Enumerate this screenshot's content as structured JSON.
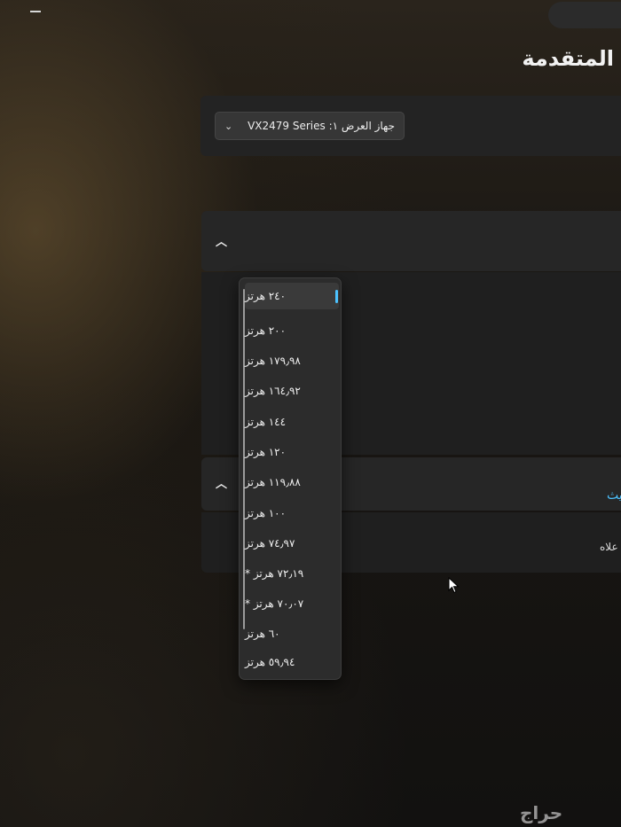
{
  "page": {
    "title": "المتقدمة"
  },
  "display": {
    "select_label": "جهاز العرض ١: VX2479 Series"
  },
  "sections": {
    "section2_link_fragment": "يث",
    "section2_text_fragment": "علاه"
  },
  "refresh_rate_dropdown": {
    "selected_index": 0,
    "options": [
      "٢٤٠ هرتز",
      "٢٠٠ هرتز",
      "١٧٩٫٩٨ هرتز",
      "١٦٤٫٩٢ هرتز",
      "١٤٤ هرتز",
      "١٢٠ هرتز",
      "١١٩٫٨٨ هرتز",
      "١٠٠ هرتز",
      "٧٤٫٩٧ هرتز",
      "٧٢٫١٩ هرتز *",
      "٧٠٫٠٧ هرتز *",
      "٦٠ هرتز",
      "٥٩٫٩٤ هرتز"
    ]
  },
  "watermark": {
    "text": "حراج"
  },
  "colors": {
    "accent": "#4cc2ff",
    "panel": "#232323",
    "dropdown_bg": "#2c2c2c"
  },
  "icons": {
    "collapse": "chevron-up-icon",
    "expand": "chevron-down-icon",
    "pointer": "mouse-cursor-icon"
  }
}
